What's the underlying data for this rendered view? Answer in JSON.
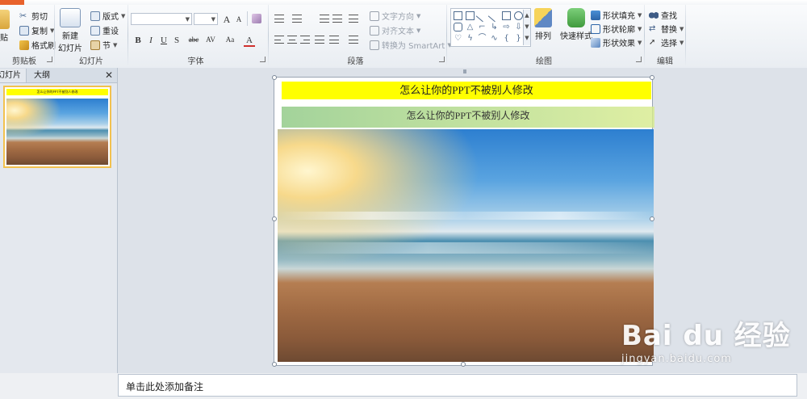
{
  "colors": {
    "accent": "#e8622c",
    "title_bar": "#ffff00",
    "selected_thumb_border": "#f2c14e"
  },
  "clipboard": {
    "paste_label": "粘贴",
    "cut_label": "剪切",
    "copy_label": "复制",
    "format_painter_label": "格式刷",
    "group_label": "剪贴板"
  },
  "slides_group": {
    "new_slide_label_1": "新建",
    "new_slide_label_2": "幻灯片",
    "layout_label": "版式",
    "reset_label": "重设",
    "section_label": "节",
    "group_label": "幻灯片"
  },
  "font_group": {
    "bold": "B",
    "italic": "I",
    "underline": "U",
    "shadow": "S",
    "strikethrough": "abc",
    "spacing": "AV",
    "case": "Aa",
    "color": "A",
    "grow": "A",
    "shrink": "A",
    "group_label": "字体"
  },
  "paragraph_group": {
    "text_direction_label": "文字方向",
    "align_text_label": "对齐文本",
    "smartart_label": "转换为 SmartArt",
    "group_label": "段落"
  },
  "drawing_group": {
    "arrange_label": "排列",
    "quick_styles_label": "快速样式",
    "shape_fill_label": "形状填充",
    "shape_outline_label": "形状轮廓",
    "shape_effects_label": "形状效果",
    "group_label": "绘图"
  },
  "editing_group": {
    "find_label": "查找",
    "replace_label": "替换",
    "select_label": "选择",
    "group_label": "编辑"
  },
  "left_pane": {
    "tab_slides": "幻灯片",
    "tab_outline": "大纲",
    "close_glyph": "✕",
    "thumb_number": "1"
  },
  "slide": {
    "title_top": "怎么让你的PPT不被别人修改",
    "title_second": "怎么让你的PPT不被别人修改"
  },
  "notes": {
    "placeholder": "单击此处添加备注"
  },
  "watermark": {
    "brand": "Bai du 经验",
    "url": "jingyan.baidu.com"
  }
}
